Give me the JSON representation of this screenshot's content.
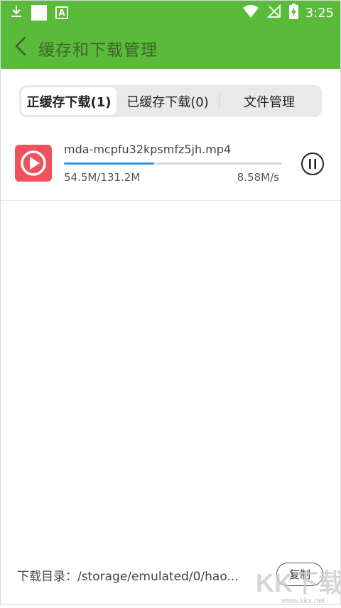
{
  "status_bar": {
    "time": "3:25",
    "left_icons": [
      "download-icon",
      "white-square-icon",
      "a-badge-icon"
    ],
    "right_icons": [
      "wifi-icon",
      "no-signal-icon",
      "battery-charging-icon"
    ]
  },
  "header": {
    "title": "缓存和下载管理",
    "back_icon": "chevron-left-icon",
    "background_color": "#5aba3a"
  },
  "tabs": [
    {
      "label": "正缓存下载(1)",
      "active": true
    },
    {
      "label": "已缓存下载(0)",
      "active": false
    },
    {
      "label": "文件管理",
      "active": false
    }
  ],
  "downloads": [
    {
      "icon": "video-play-icon",
      "filename": "mda-mcpfu32kpsmfz5jh.mp4",
      "downloaded": "54.5M/131.2M",
      "progress_fraction": 0.415,
      "speed": "8.58M/s",
      "action_icon": "pause-icon"
    }
  ],
  "footer": {
    "path_label": "下载目录：/storage/emulated/0/hao...",
    "copy_label": "复制"
  },
  "watermark": {
    "text": "KK下载",
    "url_text": "www.kkx.net"
  },
  "colors": {
    "accent_green": "#5aba3a",
    "progress_blue": "#2a9bd8",
    "video_icon_red": "#f0525d"
  }
}
